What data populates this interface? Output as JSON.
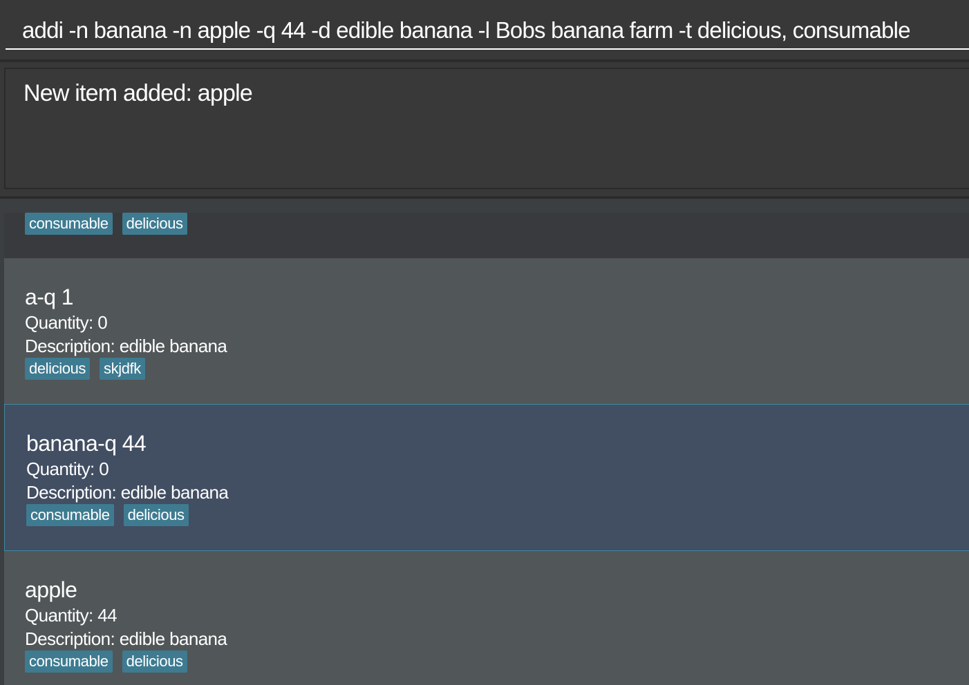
{
  "command_box": {
    "value": "addi -n banana -n apple -q 44 -d edible banana -l Bobs banana farm -t delicious, consumable"
  },
  "result_display": {
    "text": "New item added: apple"
  },
  "item_list": {
    "partial_item": {
      "tags": [
        "consumable",
        "delicious"
      ]
    },
    "items": [
      {
        "name": "a-q 1",
        "quantity": "Quantity: 0",
        "description": "Description: edible banana",
        "tags": [
          "delicious",
          "skjdfk"
        ],
        "selected": false
      },
      {
        "name": "banana-q 44",
        "quantity": "Quantity: 0",
        "description": "Description: edible banana",
        "tags": [
          "consumable",
          "delicious"
        ],
        "selected": true
      },
      {
        "name": "apple",
        "quantity": "Quantity: 44",
        "description": "Description: edible banana",
        "tags": [
          "consumable",
          "delicious"
        ],
        "selected": false
      }
    ]
  },
  "colors": {
    "background": "#3c3f41",
    "card": "#515658",
    "card_selected": "#424e62",
    "selection_border": "#3d8aa6",
    "tag": "#3e7b91",
    "text": "#ffffff"
  }
}
